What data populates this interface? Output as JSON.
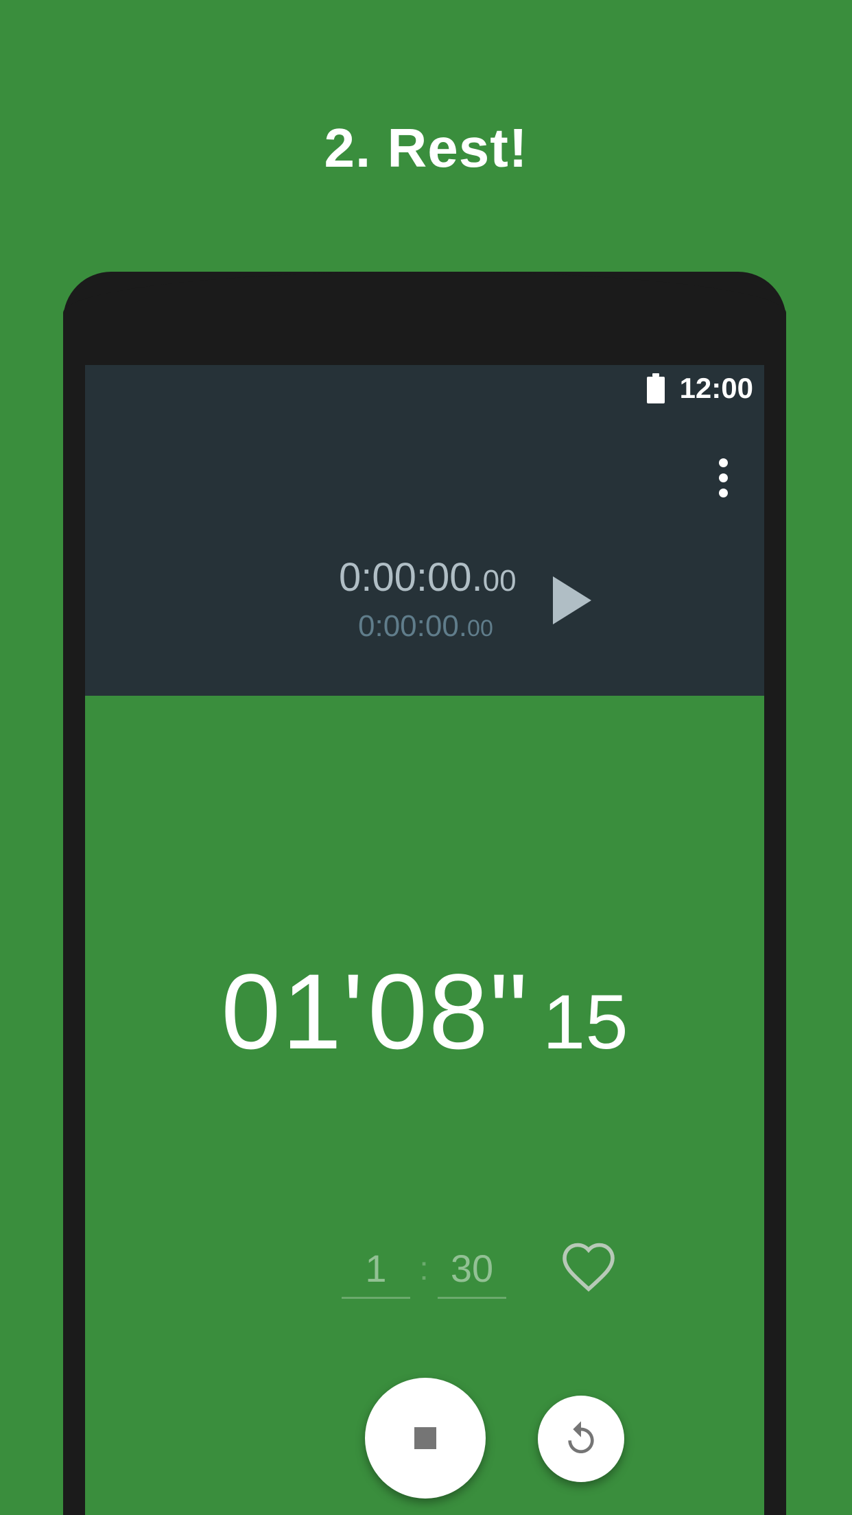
{
  "headline": "2. Rest!",
  "colors": {
    "background": "#3a8e3d",
    "appbar": "#263238",
    "phone_frame": "#1b1b1b"
  },
  "status_bar": {
    "battery_icon": "battery-full-icon",
    "time": "12:00"
  },
  "appbar": {
    "menu_icon": "more-vert-icon",
    "total_time": {
      "main": "0:00:00.",
      "fraction": "00"
    },
    "lap_time": {
      "main": "0:00:00.",
      "fraction": "00"
    },
    "play_icon": "play-icon"
  },
  "timer": {
    "minutes": "01'",
    "seconds": "08\"",
    "hundredths": "15"
  },
  "interval": {
    "minutes": "1",
    "separator": ":",
    "seconds": "30",
    "favorite_icon": "heart-outline-icon"
  },
  "controls": {
    "stop_icon": "stop-icon",
    "reset_icon": "reset-icon"
  }
}
